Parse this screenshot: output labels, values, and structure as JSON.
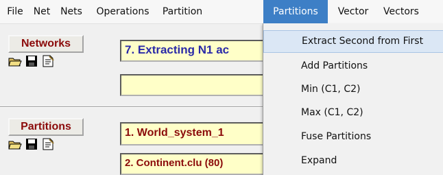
{
  "menubar": {
    "items": [
      "File",
      "Net",
      "Nets",
      "Operations",
      "Partition",
      "Partitions",
      "Vector",
      "Vectors"
    ],
    "active_index": 5
  },
  "networks": {
    "label": "Networks",
    "field1": "7. Extracting N1 ac",
    "field2": ""
  },
  "partitions": {
    "label": "Partitions",
    "field1": "1. World_system_1",
    "field2": "2. Continent.clu (80)"
  },
  "icons": [
    "open-folder-icon",
    "save-disk-icon",
    "edit-file-icon"
  ],
  "dropdown": {
    "items": [
      "Extract Second from First",
      "Add Partitions",
      "Min (C1, C2)",
      "Max (C1, C2)",
      "Fuse Partitions",
      "Expand"
    ],
    "highlighted_index": 0
  },
  "colors": {
    "menu_active_bg": "#3d7fc6",
    "label_text": "#8b0a0a",
    "field_bg": "#ffffc8",
    "network_field_text": "#2a2aa8",
    "dropdown_highlight": "#dbe7f5"
  }
}
